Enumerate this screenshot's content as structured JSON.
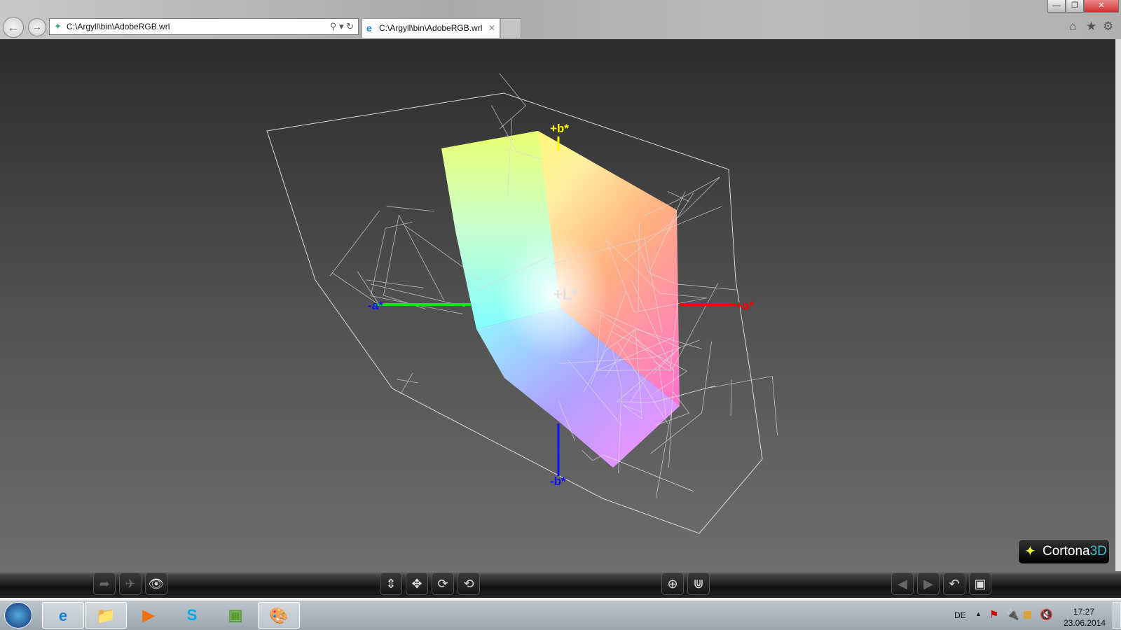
{
  "browser": {
    "address": "C:\\Argyll\\bin\\AdobeRGB.wrl",
    "tab_title": "C:\\Argyll\\bin\\AdobeRGB.wrl",
    "back_icon": "back-arrow-icon",
    "forward_icon": "forward-arrow-icon"
  },
  "viewer": {
    "axes": {
      "plus_b": "+b*",
      "minus_b": "-b*",
      "plus_a": "+a*",
      "minus_a": "-a*",
      "plus_l": "+L*"
    },
    "colors": {
      "plus_b": "#ffff00",
      "minus_b": "#0000ff",
      "plus_a": "#ff0000",
      "minus_a": "#00ff00",
      "wireframe": "#d8d8d8"
    },
    "logo": {
      "name": "Cortona",
      "suffix": "3D"
    }
  },
  "toolbar": {
    "left": [
      "go-icon",
      "fly-icon",
      "view-icon"
    ],
    "center": [
      "plane-icon",
      "pan-icon",
      "turn-icon",
      "roll-icon"
    ],
    "right1": [
      "fit-icon",
      "straighten-icon"
    ],
    "right2": [
      "previous-icon",
      "next-icon",
      "undo-icon",
      "fullscreen-icon"
    ]
  },
  "taskbar": {
    "language": "DE",
    "time": "17:27",
    "date": "23.06.2014"
  }
}
